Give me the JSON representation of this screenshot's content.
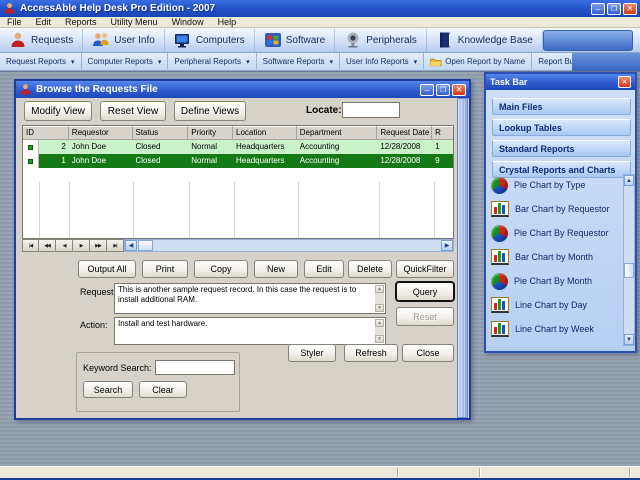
{
  "window": {
    "title": "AccessAble Help Desk Pro Edition - 2007"
  },
  "menu": {
    "items": [
      "File",
      "Edit",
      "Reports",
      "Utility Menu",
      "Window",
      "Help"
    ]
  },
  "toolbar": {
    "buttons": [
      {
        "label": "Requests",
        "icon": "person-icon"
      },
      {
        "label": "User Info",
        "icon": "two-people-icon"
      },
      {
        "label": "Computers",
        "icon": "monitor-icon"
      },
      {
        "label": "Software",
        "icon": "windows-logo-icon"
      },
      {
        "label": "Peripherals",
        "icon": "webcam-icon"
      },
      {
        "label": "Knowledge Base",
        "icon": "book-icon"
      }
    ]
  },
  "reportbar": {
    "buttons": [
      {
        "label": "Request Reports",
        "dropdown": true
      },
      {
        "label": "Computer Reports",
        "dropdown": true
      },
      {
        "label": "Peripheral Reports",
        "dropdown": true
      },
      {
        "label": "Software Reports",
        "dropdown": true
      },
      {
        "label": "User Info Reports",
        "dropdown": true
      },
      {
        "label": "Open Report by Name",
        "dropdown": false,
        "icon": "folder-icon"
      },
      {
        "label": "Report Builder",
        "dropdown": false
      }
    ]
  },
  "dialog": {
    "title": "Browse the Requests File",
    "view_buttons": [
      "Modify View",
      "Reset View",
      "Define Views"
    ],
    "locate": {
      "label": "Locate:",
      "value": ""
    },
    "grid": {
      "columns": [
        "ID",
        "Requestor",
        "Status",
        "Priority",
        "Location",
        "Department",
        "Request Date",
        "R"
      ],
      "rows": [
        {
          "id": "2",
          "requestor": "John Doe",
          "status": "Closed",
          "priority": "Normal",
          "location": "Headquarters",
          "department": "Accounting",
          "request_date": "12/28/2008",
          "extra": "1"
        },
        {
          "id": "1",
          "requestor": "John Doe",
          "status": "Closed",
          "priority": "Normal",
          "location": "Headquarters",
          "department": "Accounting",
          "request_date": "12/28/2008",
          "extra": "9"
        }
      ]
    },
    "nav_buttons": [
      "|◀",
      "◀◀",
      "◀",
      "▶",
      "▶▶",
      "▶|"
    ],
    "record_buttons": [
      "Output All",
      "Print",
      "Copy",
      "New",
      "Edit",
      "Delete"
    ],
    "quickfilter_button": "QuickFilter",
    "request": {
      "label": "Request:",
      "text": "This is another sample request record.  In this case the request is to install additional RAM."
    },
    "action": {
      "label": "Action:",
      "text": "Install and test hardware."
    },
    "query_button": "Query",
    "reset_button": "Reset",
    "styler_button": "Styler",
    "refresh_button": "Refresh",
    "close_button": "Close",
    "keyword": {
      "label": "Keyword Search:",
      "value": "",
      "search_button": "Search",
      "clear_button": "Clear"
    }
  },
  "taskbar": {
    "title": "Task Bar",
    "bands": [
      "Main Files",
      "Lookup Tables",
      "Standard Reports",
      "Crystal Reports and Charts"
    ],
    "items": [
      {
        "label": "Pie Chart by Type",
        "icon": "pie-chart-icon"
      },
      {
        "label": "Bar Chart by Requestor",
        "icon": "bar-chart-icon"
      },
      {
        "label": "Pie Chart By Requestor",
        "icon": "pie-chart-icon"
      },
      {
        "label": "Bar Chart by Month",
        "icon": "bar-chart-icon"
      },
      {
        "label": "Pie Chart By Month",
        "icon": "pie-chart-icon"
      },
      {
        "label": "Line Chart by Day",
        "icon": "bar-chart-icon"
      },
      {
        "label": "Line Chart by Week",
        "icon": "bar-chart-icon"
      }
    ]
  },
  "colors": {
    "titlebar_blue": "#2456cc",
    "selected_row_green": "#157a15",
    "row_green": "#c9f2c9",
    "taskbar_text_navy": "#0c2c78",
    "status_bar_beige": "#ece9d8"
  }
}
